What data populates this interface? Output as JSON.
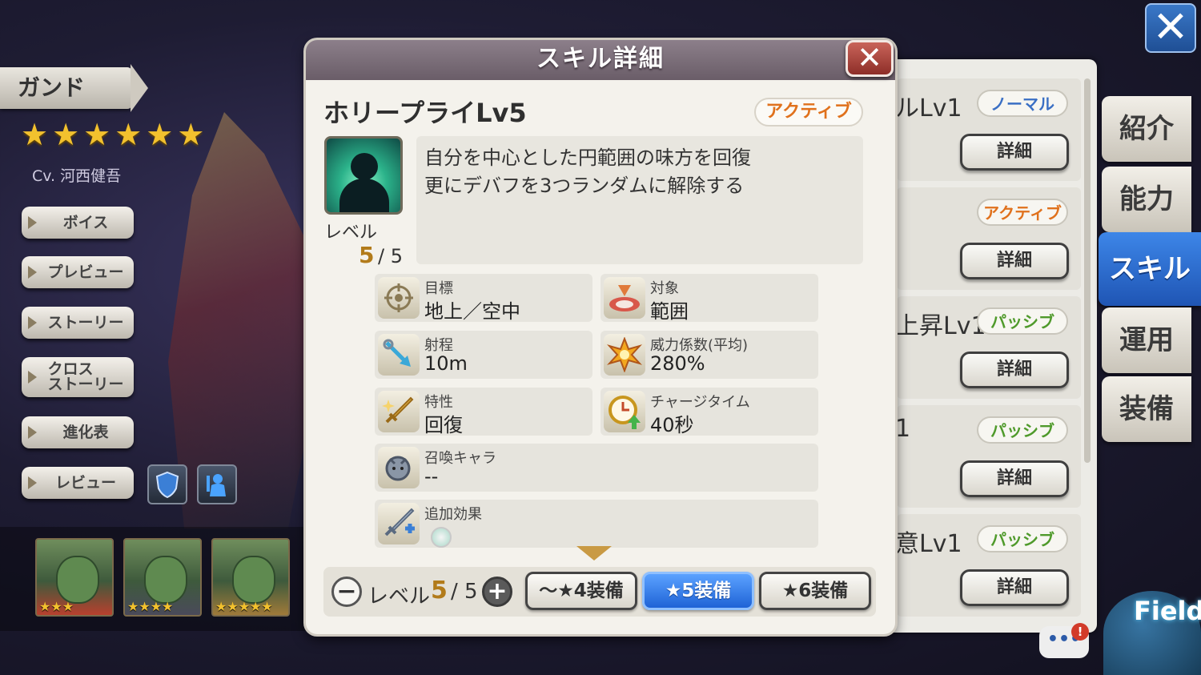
{
  "character": {
    "name": "ガンド",
    "stars": "★★★★★★",
    "cv": "Cv. 河西健吾",
    "menu": [
      {
        "label": "ボイス"
      },
      {
        "label": "プレビュー"
      },
      {
        "label": "ストーリー"
      },
      {
        "label": "クロス\nストーリー"
      },
      {
        "label": "進化表"
      },
      {
        "label": "レビュー"
      }
    ],
    "portrait_stars": [
      "★★★",
      "★★★★",
      "★★★★★"
    ]
  },
  "top_close": "✕",
  "right_tabs": [
    {
      "label": "紹介"
    },
    {
      "label": "能力"
    },
    {
      "label": "スキル"
    },
    {
      "label": "運用"
    },
    {
      "label": "装備"
    }
  ],
  "back_list": [
    {
      "name_fragment": "ルLv1",
      "type": "ノーマル",
      "type_color": "#3a6fc4",
      "detail": "詳細"
    },
    {
      "name_fragment": "",
      "type": "アクティブ",
      "type_color": "#e0711c",
      "detail": "詳細"
    },
    {
      "name_fragment": "上昇Lv1",
      "type": "パッシブ",
      "type_color": "#4f9a2b",
      "detail": "詳細"
    },
    {
      "name_fragment": "1",
      "type": "パッシブ",
      "type_color": "#4f9a2b",
      "detail": "詳細"
    },
    {
      "name_fragment": "意Lv1",
      "type": "パッシブ",
      "type_color": "#4f9a2b",
      "detail": "詳細"
    }
  ],
  "field": {
    "label": "Field",
    "chat": "•••",
    "badge": "!"
  },
  "modal": {
    "title": "スキル詳細",
    "close": "✕",
    "skill_name": "ホリープライLv5",
    "skill_type": "アクティブ",
    "level_label": "レベル",
    "level_current": "5",
    "level_max": "/ 5",
    "description": [
      "自分を中心とした円範囲の味方を回復",
      "更にデバフを3つランダムに解除する"
    ],
    "stats": {
      "target": {
        "label": "目標",
        "value": "地上／空中"
      },
      "scope": {
        "label": "対象",
        "value": "範囲"
      },
      "range": {
        "label": "射程",
        "value": "10m"
      },
      "power": {
        "label": "威力係数(平均)",
        "value": "280%"
      },
      "trait": {
        "label": "特性",
        "value": "回復"
      },
      "charge": {
        "label": "チャージタイム",
        "value": "40秒"
      },
      "summon": {
        "label": "召喚キャラ",
        "value": "--"
      },
      "extra": {
        "label": "追加効果",
        "value": ""
      }
    },
    "bottom": {
      "minus": "−",
      "plus": "+",
      "level_label": "レベル",
      "level_current": "5",
      "level_max": "/ 5",
      "equip_buttons": [
        "〜★4装備",
        "★5装備",
        "★6装備"
      ],
      "selected_index": 1
    }
  }
}
